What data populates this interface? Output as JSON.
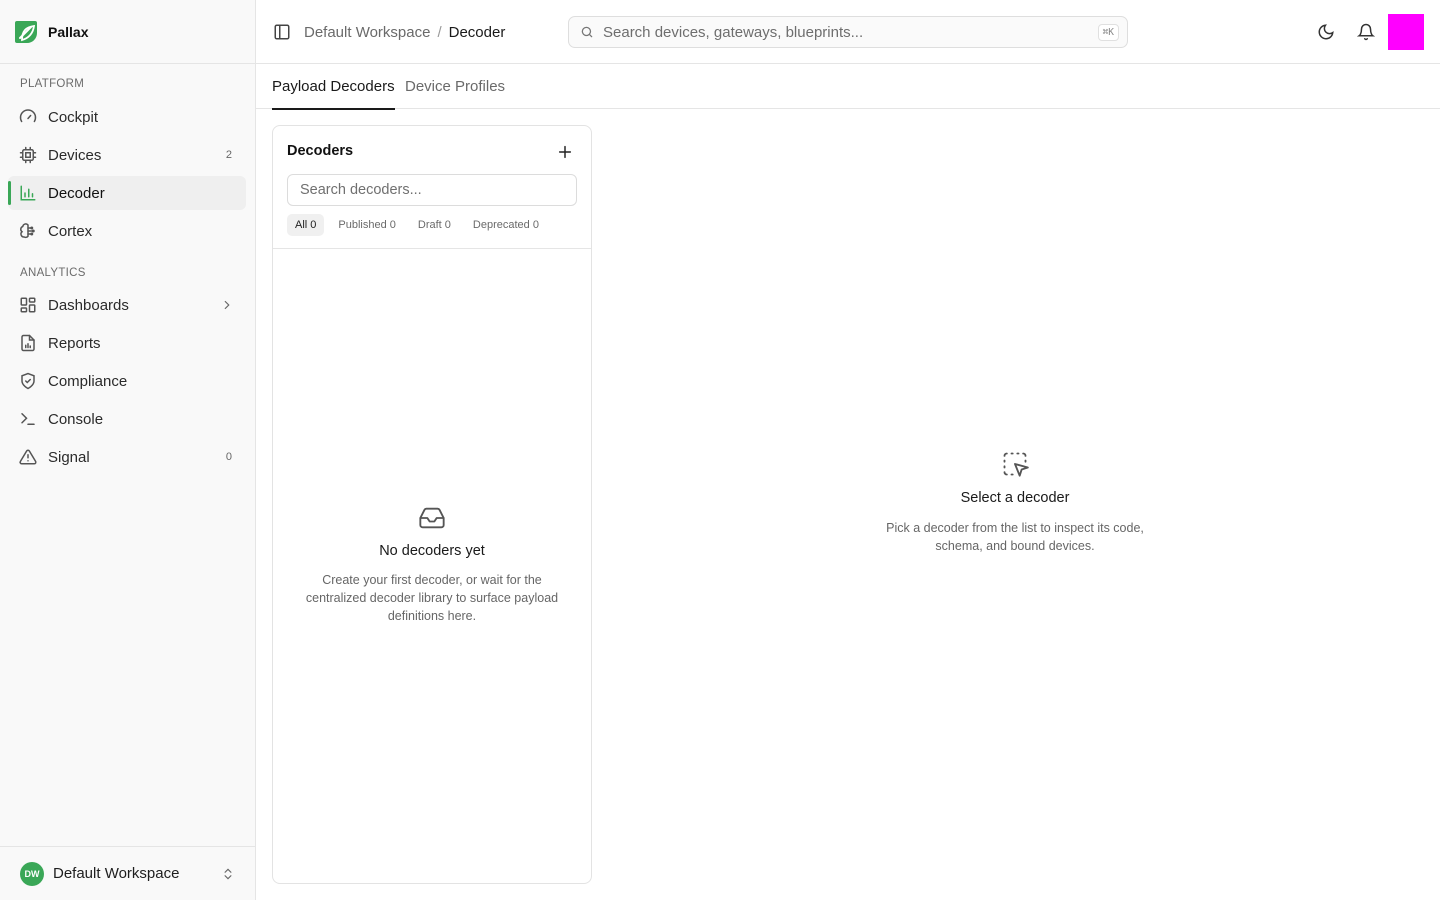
{
  "brand": {
    "name": "Pallax"
  },
  "sidebar": {
    "sections": [
      {
        "label": "PLATFORM"
      },
      {
        "label": "ANALYTICS"
      }
    ],
    "items": [
      {
        "label": "Cockpit",
        "icon": "gauge-icon"
      },
      {
        "label": "Devices",
        "icon": "chip-icon",
        "badge": "2"
      },
      {
        "label": "Decoder",
        "icon": "bar-chart-icon",
        "active": true
      },
      {
        "label": "Cortex",
        "icon": "brain-icon"
      },
      {
        "label": "Dashboards",
        "icon": "layout-grid-icon",
        "has_submenu": true
      },
      {
        "label": "Reports",
        "icon": "file-chart-icon"
      },
      {
        "label": "Compliance",
        "icon": "shield-check-icon"
      },
      {
        "label": "Console",
        "icon": "terminal-icon"
      },
      {
        "label": "Signal",
        "icon": "alert-triangle-icon",
        "badge": "0"
      }
    ],
    "workspace": {
      "initials": "DW",
      "name": "Default Workspace"
    }
  },
  "header": {
    "breadcrumb": {
      "parent": "Default Workspace",
      "separator": "/",
      "current": "Decoder"
    },
    "search": {
      "placeholder": "Search devices, gateways, blueprints...",
      "shortcut": "⌘K"
    }
  },
  "tabs": [
    {
      "label": "Payload Decoders",
      "active": true
    },
    {
      "label": "Device Profiles",
      "active": false
    }
  ],
  "decoders_panel": {
    "title": "Decoders",
    "search_placeholder": "Search decoders...",
    "filters": [
      {
        "label": "All 0",
        "active": true
      },
      {
        "label": "Published 0",
        "active": false
      },
      {
        "label": "Draft 0",
        "active": false
      },
      {
        "label": "Deprecated 0",
        "active": false
      }
    ],
    "empty": {
      "title": "No decoders yet",
      "description": "Create your first decoder, or wait for the centralized decoder library to surface payload definitions here."
    }
  },
  "detail": {
    "empty": {
      "title": "Select a decoder",
      "description": "Pick a decoder from the list to inspect its code, schema, and bound devices."
    }
  },
  "colors": {
    "accent": "#3aa757",
    "avatar": "#ff00ff"
  }
}
